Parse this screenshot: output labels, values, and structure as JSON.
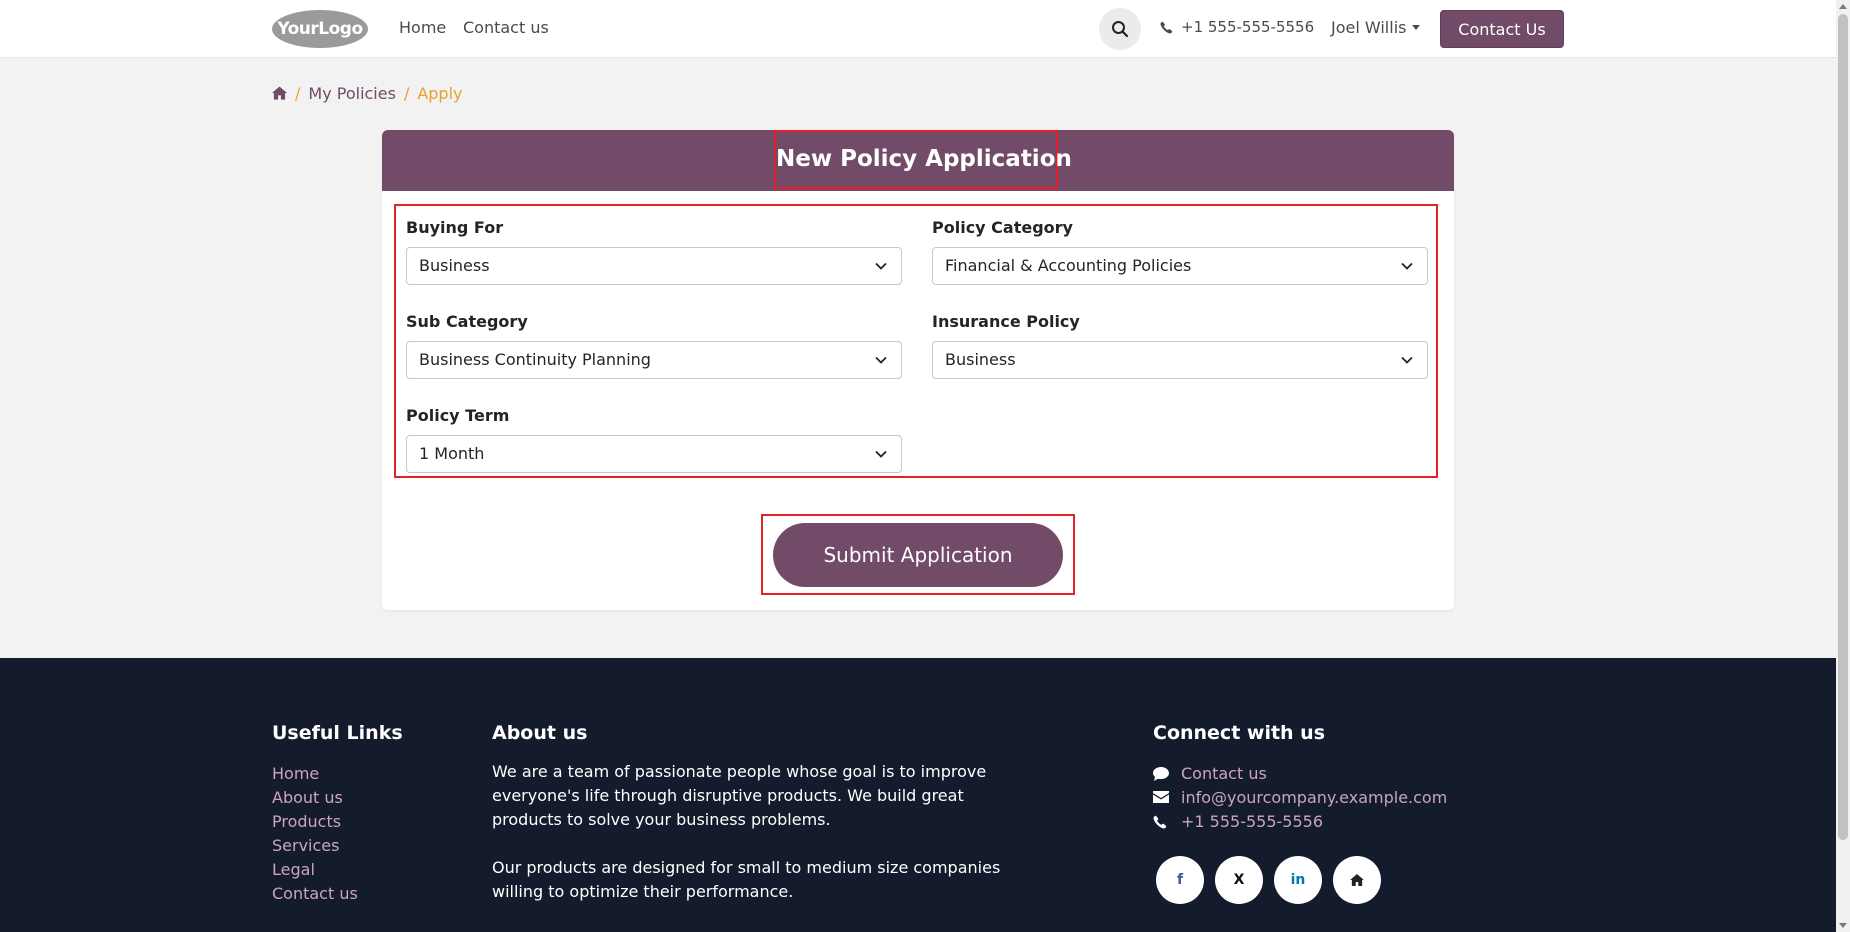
{
  "header": {
    "logo_text": "YourLogo",
    "nav": [
      "Home",
      "Contact us"
    ],
    "phone": "+1 555-555-5556",
    "user": "Joel Willis",
    "contact_button": "Contact Us"
  },
  "breadcrumb": {
    "items": [
      "My Policies",
      "Apply"
    ],
    "separator": "/"
  },
  "form": {
    "title": "New Policy Application",
    "fields": [
      {
        "label": "Buying For",
        "value": "Business"
      },
      {
        "label": "Policy Category",
        "value": "Financial & Accounting Policies"
      },
      {
        "label": "Sub Category",
        "value": "Business Continuity Planning"
      },
      {
        "label": "Insurance Policy",
        "value": "Business"
      },
      {
        "label": "Policy Term",
        "value": "1 Month"
      }
    ],
    "submit_label": "Submit Application"
  },
  "footer": {
    "useful_links": {
      "title": "Useful Links",
      "items": [
        "Home",
        "About us",
        "Products",
        "Services",
        "Legal",
        "Contact us"
      ]
    },
    "about": {
      "title": "About us",
      "lines1": [
        "We are a team of passionate people whose goal is to improve",
        "everyone's life through disruptive products. We build great",
        "products to solve your business problems."
      ],
      "lines2": [
        "Our products are designed for small to medium size companies",
        "willing to optimize their performance."
      ]
    },
    "connect": {
      "title": "Connect with us",
      "contact": "Contact us",
      "email": "info@yourcompany.example.com",
      "phone": "+1 555-555-5556",
      "social": [
        {
          "icon": "facebook-icon",
          "glyph": "f",
          "color": "#3b5998"
        },
        {
          "icon": "x-twitter-icon",
          "glyph": "X",
          "color": "#111111"
        },
        {
          "icon": "linkedin-icon",
          "glyph": "in",
          "color": "#0077b5"
        },
        {
          "icon": "home-icon",
          "glyph": "",
          "color": "#111111"
        }
      ]
    }
  },
  "colors": {
    "brand": "#714b67",
    "accent": "#e8a32c",
    "footer_bg": "#141b2d",
    "highlight": "#e4202a"
  }
}
